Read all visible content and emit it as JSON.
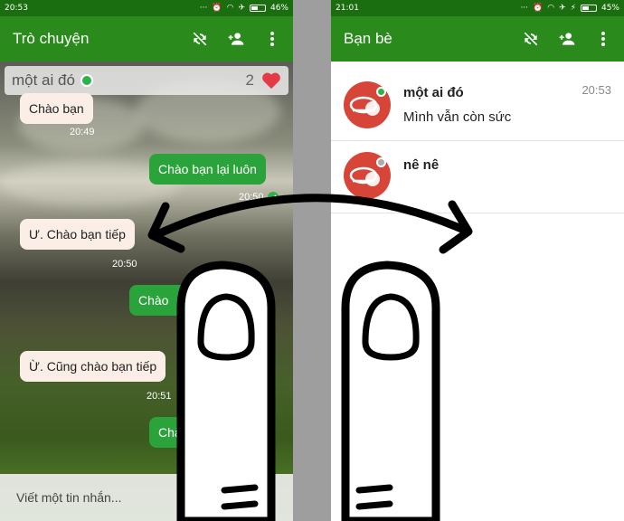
{
  "left": {
    "status_time": "20:53",
    "status_battery": "46%",
    "title": "Trò chuyện",
    "search_name": "một ai đó",
    "search_count": "2",
    "messages": [
      {
        "text": "Chào bạn",
        "time": "20:49"
      },
      {
        "text": "Chào bạn lại luôn",
        "time": "20:50"
      },
      {
        "text": "Ư. Chào bạn tiếp",
        "time": "20:50"
      },
      {
        "text": "Chào"
      },
      {
        "text": "Ừ. Cũng chào bạn tiếp",
        "time": "20:51"
      },
      {
        "text": "Chào"
      }
    ],
    "composer_placeholder": "Viết một tin nhắn..."
  },
  "right": {
    "status_time": "21:01",
    "status_battery": "45%",
    "title": "Bạn bè",
    "friends": [
      {
        "name": "một ai đó",
        "message": "Mình  vẫn còn sức",
        "time": "20:53",
        "presence": "online"
      },
      {
        "name": "nê nê",
        "message": "",
        "time": "",
        "presence": "offline"
      }
    ]
  },
  "colors": {
    "statusbar": "#1b6e0f",
    "appbar": "#2a8a1c",
    "outgoing": "#2aa33a",
    "incoming": "#fbeee6",
    "online": "#2db34a",
    "offline": "#aaaaaa",
    "avatar": "#d64538"
  },
  "icons": [
    "sync-off-icon",
    "add-person-icon",
    "more-vert-icon",
    "heart-icon",
    "check-icon",
    "cloud-sun-avatar-icon",
    "swipe-arrow-icon",
    "two-finger-gesture-icon"
  ]
}
